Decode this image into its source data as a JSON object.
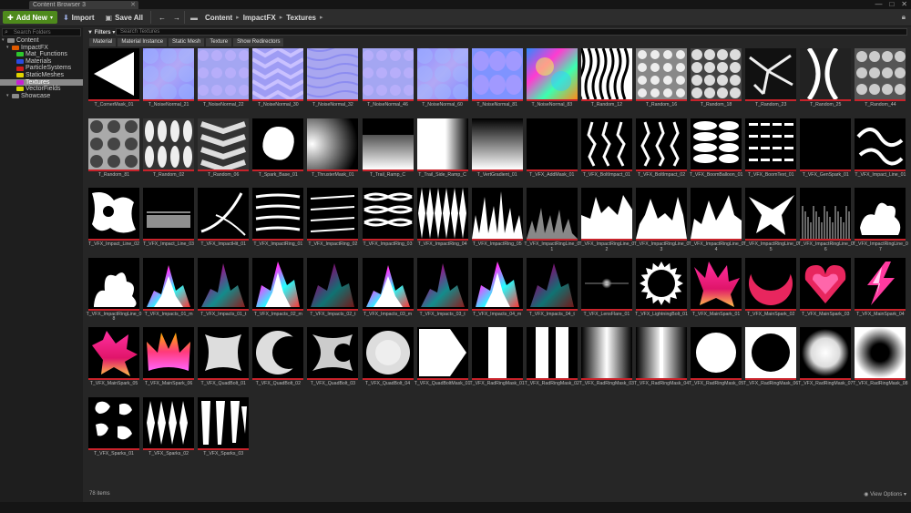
{
  "window": {
    "tab_title": "Content Browser 3",
    "min": "—",
    "max": "□",
    "close": "✕"
  },
  "toolbar": {
    "add_new": "Add New",
    "import": "Import",
    "save_all": "Save All",
    "crumbs": [
      "Content",
      "ImpactFX",
      "Textures"
    ]
  },
  "folders": {
    "search_placeholder": "Search Folders",
    "tree": [
      {
        "label": "Content",
        "level": 0,
        "color": "#8a8a8a"
      },
      {
        "label": "ImpactFX",
        "level": 1,
        "color": "#e05a00"
      },
      {
        "label": "Mat_Functions",
        "level": 2,
        "color": "#2ec72e"
      },
      {
        "label": "Materials",
        "level": 2,
        "color": "#2b4be0"
      },
      {
        "label": "ParticleSystems",
        "level": 2,
        "color": "#d21c1c"
      },
      {
        "label": "StaticMeshes",
        "level": 2,
        "color": "#e0d400"
      },
      {
        "label": "Textures",
        "level": 2,
        "color": "#c81fd4",
        "selected": true
      },
      {
        "label": "VectorFields",
        "level": 2,
        "color": "#d4d400"
      },
      {
        "label": "Showcase",
        "level": 1,
        "color": "#8a8a8a"
      }
    ]
  },
  "filters": {
    "label": "Filters",
    "search_placeholder": "Search Textures",
    "chips": [
      "Material",
      "Material Instance",
      "Static Mesh",
      "Texture",
      "Show Redirectors"
    ]
  },
  "assets": [
    {
      "name": "T_CornerMask_01",
      "kind": "corner"
    },
    {
      "name": "T_NoiseNormal_21",
      "kind": "normal1"
    },
    {
      "name": "T_NoiseNormal_22",
      "kind": "normal2"
    },
    {
      "name": "T_NoiseNormal_30",
      "kind": "normal3"
    },
    {
      "name": "T_NoiseNormal_32",
      "kind": "normal4"
    },
    {
      "name": "T_NoiseNormal_46",
      "kind": "normal2"
    },
    {
      "name": "T_NoiseNormal_60",
      "kind": "normal1"
    },
    {
      "name": "T_NoiseNormal_81",
      "kind": "normal5"
    },
    {
      "name": "T_NoiseNormal_83",
      "kind": "rainbow"
    },
    {
      "name": "T_Random_12",
      "kind": "zebra"
    },
    {
      "name": "T_Random_16",
      "kind": "cells"
    },
    {
      "name": "T_Random_18",
      "kind": "cells2"
    },
    {
      "name": "T_Random_23",
      "kind": "web"
    },
    {
      "name": "T_Random_25",
      "kind": "streaks"
    },
    {
      "name": "T_Random_44",
      "kind": "blobsgray"
    },
    {
      "name": "T_Random_81",
      "kind": "grayweb"
    },
    {
      "name": "T_Random_02",
      "kind": "pills"
    },
    {
      "name": "T_Random_06",
      "kind": "chevron"
    },
    {
      "name": "T_Spark_Base_01",
      "kind": "blob"
    },
    {
      "name": "T_ThrusterMask_01",
      "kind": "thruster"
    },
    {
      "name": "T_Trail_Ramp_C",
      "kind": "ramp"
    },
    {
      "name": "T_Trail_Side_Ramp_C",
      "kind": "sideramp"
    },
    {
      "name": "T_VertGradient_01",
      "kind": "vert"
    },
    {
      "name": "T_VFX_AddMask_01",
      "kind": "black"
    },
    {
      "name": "T_VFX_BoltImpact_01",
      "kind": "bolts"
    },
    {
      "name": "T_VFX_BoltImpact_02",
      "kind": "bolts2"
    },
    {
      "name": "T_VFX_BoomBalloon_01",
      "kind": "balloons"
    },
    {
      "name": "T_VFX_BoomText_01",
      "kind": "text"
    },
    {
      "name": "T_VFX_GenSpark_01",
      "kind": "black"
    },
    {
      "name": "T_VFX_Impact_Line_01",
      "kind": "squiggle"
    },
    {
      "name": "T_VFX_Impact_Line_02",
      "kind": "whiteblobs"
    },
    {
      "name": "T_VFX_Impact_Line_03",
      "kind": "fog"
    },
    {
      "name": "T_VFX_ImpactHit_01",
      "kind": "arc"
    },
    {
      "name": "T_VFX_ImpactRing_01",
      "kind": "strokes"
    },
    {
      "name": "T_VFX_ImpactRing_02",
      "kind": "strokes2"
    },
    {
      "name": "T_VFX_ImpactRing_03",
      "kind": "chains"
    },
    {
      "name": "T_VFX_ImpactRing_04",
      "kind": "diamonds"
    },
    {
      "name": "T_VFX_ImpactRing_05",
      "kind": "spikes"
    },
    {
      "name": "T_VFX_ImpactRingLine_01",
      "kind": "spikesdim"
    },
    {
      "name": "T_VFX_ImpactRingLine_02",
      "kind": "mountain"
    },
    {
      "name": "T_VFX_ImpactRingLine_03",
      "kind": "mountain2"
    },
    {
      "name": "T_VFX_ImpactRingLine_04",
      "kind": "mountain3"
    },
    {
      "name": "T_VFX_ImpactRingLine_05",
      "kind": "claw"
    },
    {
      "name": "T_VFX_ImpactRingLine_06",
      "kind": "scratch"
    },
    {
      "name": "T_VFX_ImpactRingLine_07",
      "kind": "splat"
    },
    {
      "name": "T_VFX_ImpactRingLine_08",
      "kind": "splat2"
    },
    {
      "name": "T_VFX_Impacts_01_m",
      "kind": "prism"
    },
    {
      "name": "T_VFX_Impacts_01_t",
      "kind": "prismdark"
    },
    {
      "name": "T_VFX_Impacts_02_m",
      "kind": "prism2"
    },
    {
      "name": "T_VFX_Impacts_02_t",
      "kind": "prismdark2"
    },
    {
      "name": "T_VFX_Impacts_03_m",
      "kind": "prism"
    },
    {
      "name": "T_VFX_Impacts_03_t",
      "kind": "prismdark"
    },
    {
      "name": "T_VFX_Impacts_04_m",
      "kind": "prism2"
    },
    {
      "name": "T_VFX_Impacts_04_t",
      "kind": "prismdark2"
    },
    {
      "name": "T_VFX_LensFlare_01",
      "kind": "flare"
    },
    {
      "name": "T_VFX_LightningBolt_01",
      "kind": "burst"
    },
    {
      "name": "T_VFX_MainSpark_01",
      "kind": "spark1"
    },
    {
      "name": "T_VFX_MainSpark_02",
      "kind": "crescentc"
    },
    {
      "name": "T_VFX_MainSpark_03",
      "kind": "heart"
    },
    {
      "name": "T_VFX_MainSpark_04",
      "kind": "lightning"
    },
    {
      "name": "T_VFX_MainSpark_05",
      "kind": "spark5"
    },
    {
      "name": "T_VFX_MainSpark_06",
      "kind": "crown"
    },
    {
      "name": "T_VFX_QuadBolt_01",
      "kind": "quad1"
    },
    {
      "name": "T_VFX_QuadBolt_02",
      "kind": "crescent"
    },
    {
      "name": "T_VFX_QuadBolt_03",
      "kind": "arrow"
    },
    {
      "name": "T_VFX_QuadBolt_04",
      "kind": "roundblob"
    },
    {
      "name": "T_VFX_QuadBoltMask_01",
      "kind": "pentagon"
    },
    {
      "name": "T_VFX_RadRingMask_01",
      "kind": "bars1"
    },
    {
      "name": "T_VFX_RadRingMask_02",
      "kind": "bars2"
    },
    {
      "name": "T_VFX_RadRingMask_03",
      "kind": "bars3"
    },
    {
      "name": "T_VFX_RadRingMask_04",
      "kind": "bars4"
    },
    {
      "name": "T_VFX_RadRingMask_05",
      "kind": "circle"
    },
    {
      "name": "T_VFX_RadRingMask_06",
      "kind": "disc"
    },
    {
      "name": "T_VFX_RadRingMask_07",
      "kind": "softdisc"
    },
    {
      "name": "T_VFX_RadRingMask_08",
      "kind": "hole"
    },
    {
      "name": "T_VFX_Sparks_01",
      "kind": "sparks1"
    },
    {
      "name": "T_VFX_Sparks_02",
      "kind": "sparks2"
    },
    {
      "name": "T_VFX_Sparks_03",
      "kind": "sparks3"
    }
  ],
  "status": {
    "count": "78 items",
    "view_options": "View Options"
  }
}
